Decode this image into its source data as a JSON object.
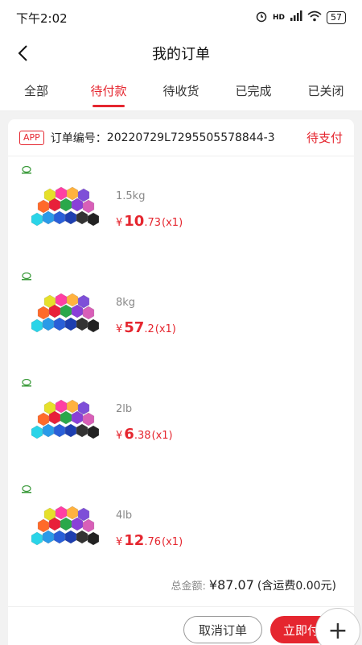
{
  "status_bar": {
    "time": "下午2:02",
    "network": "HD",
    "battery": "57"
  },
  "nav": {
    "title": "我的订单"
  },
  "tabs": [
    {
      "label": "全部",
      "active": false
    },
    {
      "label": "待付款",
      "active": true
    },
    {
      "label": "待收货",
      "active": false
    },
    {
      "label": "已完成",
      "active": false
    },
    {
      "label": "已关闭",
      "active": false
    }
  ],
  "order": {
    "app_tag": "APP",
    "order_no_label": "订单编号：",
    "order_no": "20220729L7295505578844-3",
    "status": "待支付",
    "items": [
      {
        "spec": "1.5kg",
        "currency": "¥",
        "price_int": "10",
        "price_dec": ".73",
        "qty": "(x1)"
      },
      {
        "spec": "8kg",
        "currency": "¥",
        "price_int": "57",
        "price_dec": ".2",
        "qty": "(x1)"
      },
      {
        "spec": "2lb",
        "currency": "¥",
        "price_int": "6",
        "price_dec": ".38",
        "qty": "(x1)"
      },
      {
        "spec": "4lb",
        "currency": "¥",
        "price_int": "12",
        "price_dec": ".76",
        "qty": "(x1)"
      }
    ],
    "total_label": "总金额:",
    "total_amount": "¥87.07",
    "total_note": "(含运费0.00元)",
    "cancel_label": "取消订单",
    "pay_label": "立即付款"
  },
  "colors": {
    "accent": "#e5262f"
  }
}
